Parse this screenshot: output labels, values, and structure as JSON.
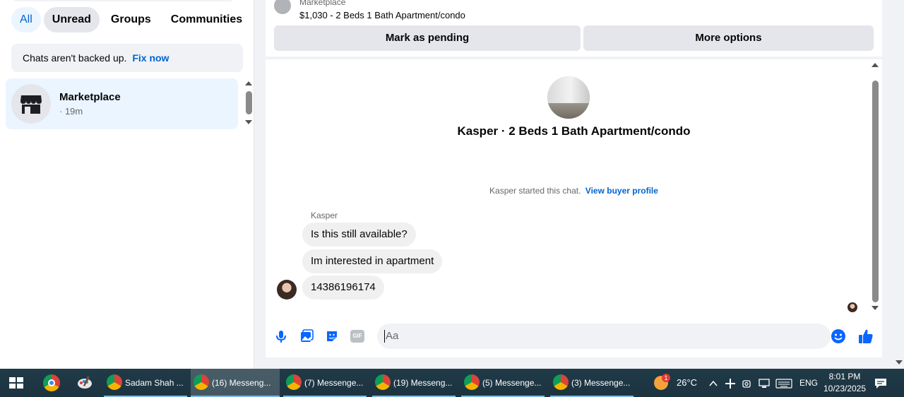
{
  "sidebar": {
    "filters": [
      "All",
      "Unread",
      "Groups",
      "Communities"
    ],
    "backup_text": "Chats aren't backed up.",
    "backup_link": "Fix now",
    "chat": {
      "title": "Marketplace",
      "subtitle": "· 19m"
    }
  },
  "listing": {
    "source": "Marketplace",
    "title": "$1,030 - 2 Beds 1 Bath Apartment/condo",
    "pending_button": "Mark as pending",
    "more_button": "More options"
  },
  "thread": {
    "product_title": "Kasper · 2 Beds 1 Bath Apartment/condo",
    "started_text": "Kasper started this chat.",
    "buyer_link": "View buyer profile",
    "sender_name": "Kasper",
    "messages": [
      "Is this still available?",
      "Im interested in apartment",
      "14386196174"
    ]
  },
  "composer": {
    "placeholder": "Aa",
    "icons": [
      "microphone-icon",
      "photo-icon",
      "sticker-icon",
      "gif-icon",
      "emoji-icon",
      "thumbs-up-icon"
    ],
    "gif_label": "GIF"
  },
  "colors": {
    "accent": "#0064d1",
    "like": "#0866ff",
    "bubble": "#f0f0f0"
  },
  "taskbar": {
    "items": [
      "Sadam Shah ...",
      "(16) Messeng...",
      "(7) Messenge...",
      "(19) Messeng...",
      "(5) Messenge...",
      "(3) Messenge..."
    ],
    "weather_badge": "1",
    "temperature": "26°C",
    "language": "ENG",
    "time": "8:01 PM",
    "date": "10/23/2025"
  }
}
